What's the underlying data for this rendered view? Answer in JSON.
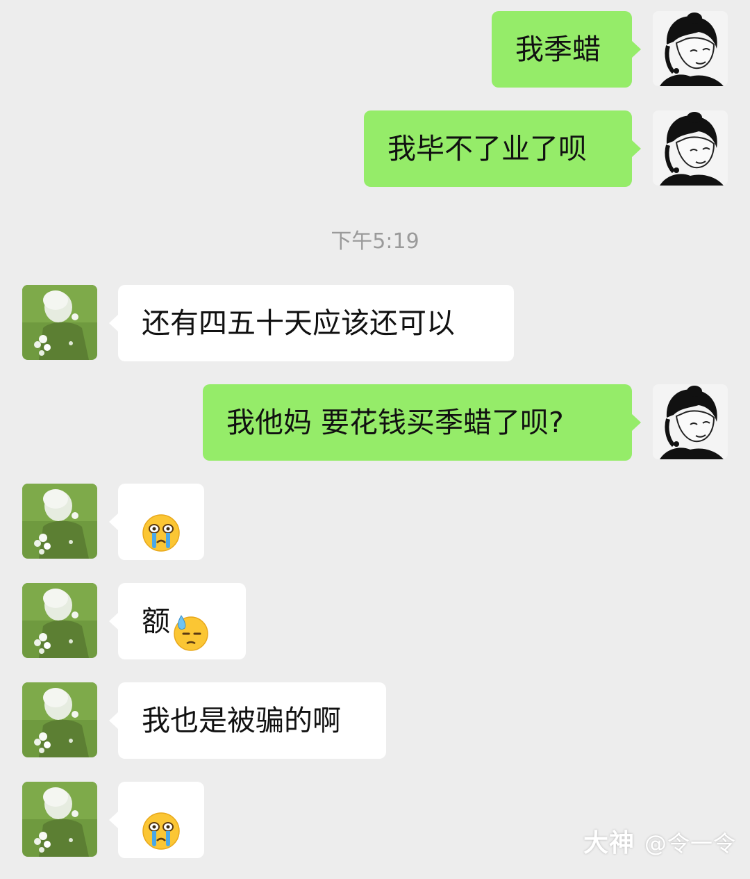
{
  "timestamp": "下午5:19",
  "messages": [
    {
      "from": "me",
      "text": "我季蜡"
    },
    {
      "from": "me",
      "text": "我毕不了业了呗"
    },
    {
      "from": "them",
      "text": "还有四五十天应该还可以"
    },
    {
      "from": "me",
      "text": "我他妈  要花钱买季蜡了呗?"
    },
    {
      "from": "them",
      "emoji": "crying-face-icon"
    },
    {
      "from": "them",
      "text": "额",
      "emoji": "downcast-sweat-face-icon"
    },
    {
      "from": "them",
      "text": "我也是被骗的啊"
    },
    {
      "from": "them",
      "emoji": "crying-face-icon"
    }
  ],
  "watermark": {
    "brand": "大神",
    "handle": "@令一令"
  },
  "colors": {
    "background": "#ededed",
    "my_bubble": "#95ec69",
    "their_bubble": "#ffffff"
  }
}
